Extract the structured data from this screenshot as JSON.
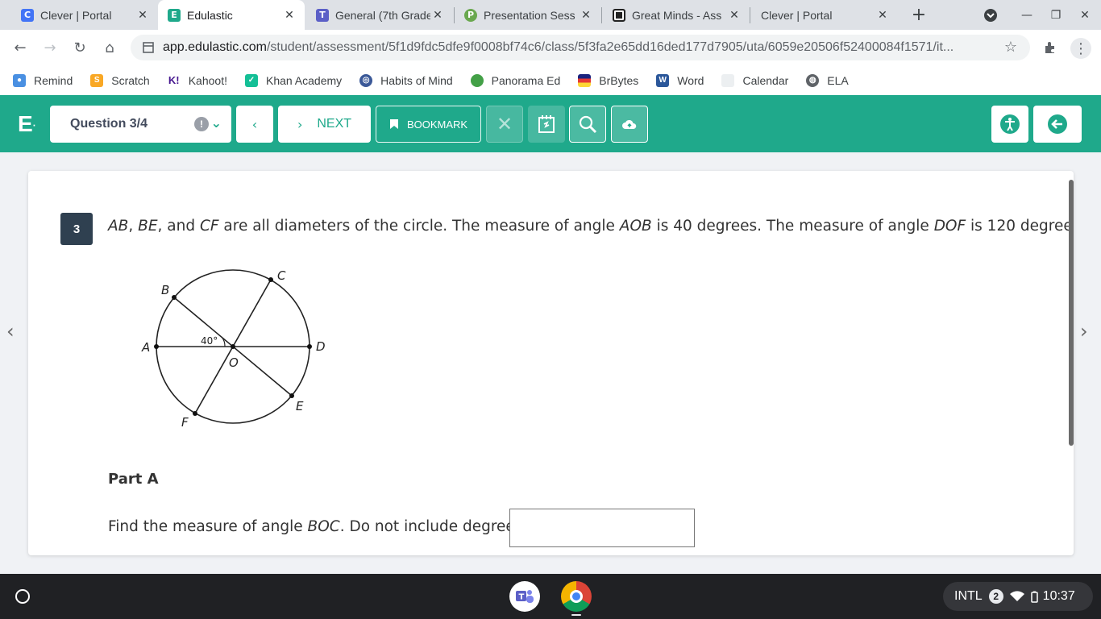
{
  "tabs": [
    {
      "title": "Clever | Portal",
      "icon": "clever-icon",
      "color": "#4274f6"
    },
    {
      "title": "Edulastic",
      "icon": "edulastic-icon",
      "color": "#1fa98b"
    },
    {
      "title": "General (7th Grade",
      "icon": "teams-icon",
      "color": "#5b5fc7"
    },
    {
      "title": "Presentation Sess",
      "icon": "pear-deck-icon",
      "color": "#6aa84f"
    },
    {
      "title": "Great Minds - Ass",
      "icon": "great-minds-icon",
      "color": "#222222"
    },
    {
      "title": "Clever | Portal",
      "icon": "clever-icon",
      "color": "#4274f6"
    }
  ],
  "omnibox": {
    "host": "app.edulastic.com",
    "path": "/student/assessment/5f1d9fdc5dfe9f0008bf74c6/class/5f3fa2e65dd16ded177d7905/uta/6059e20506f52400084f1571/it..."
  },
  "bookmarks": [
    {
      "label": "Remind",
      "icon": "remind-icon",
      "color": "#4a90e2"
    },
    {
      "label": "Scratch",
      "icon": "scratch-icon",
      "color": "#f9a825"
    },
    {
      "label": "Kahoot!",
      "icon": "kahoot-icon",
      "color": "#46178f"
    },
    {
      "label": "Khan Academy",
      "icon": "khan-academy-icon",
      "color": "#14bf96"
    },
    {
      "label": "Habits of Mind",
      "icon": "habits-of-mind-icon",
      "color": "#3b5998"
    },
    {
      "label": "Panorama Ed",
      "icon": "panorama-icon",
      "color": "#43a047"
    },
    {
      "label": "BrBytes",
      "icon": "brbytes-icon",
      "color": "#1a237e"
    },
    {
      "label": "Word",
      "icon": "word-icon",
      "color": "#2b579a"
    },
    {
      "label": "Calendar",
      "icon": "calendar-icon",
      "color": "#cfd8dc"
    },
    {
      "label": "ELA",
      "icon": "ela-icon",
      "color": "#5f6368"
    }
  ],
  "header": {
    "question_select": "Question 3/4",
    "next_label": "NEXT",
    "bookmark_label": "BOOKMARK",
    "brand_color": "#1fa98b"
  },
  "question": {
    "number": "3",
    "part_label": "Part A",
    "prompt_pre": "Find the measure of angle ",
    "prompt_angle": "BOC",
    "prompt_post": ". Do not include degrees.",
    "answer_value": ""
  },
  "figure": {
    "points": [
      "A",
      "B",
      "C",
      "D",
      "E",
      "F",
      "O"
    ],
    "angle_label": "40°"
  },
  "shelf": {
    "input_method": "INTL",
    "notifications": "2",
    "time": "10:37"
  }
}
